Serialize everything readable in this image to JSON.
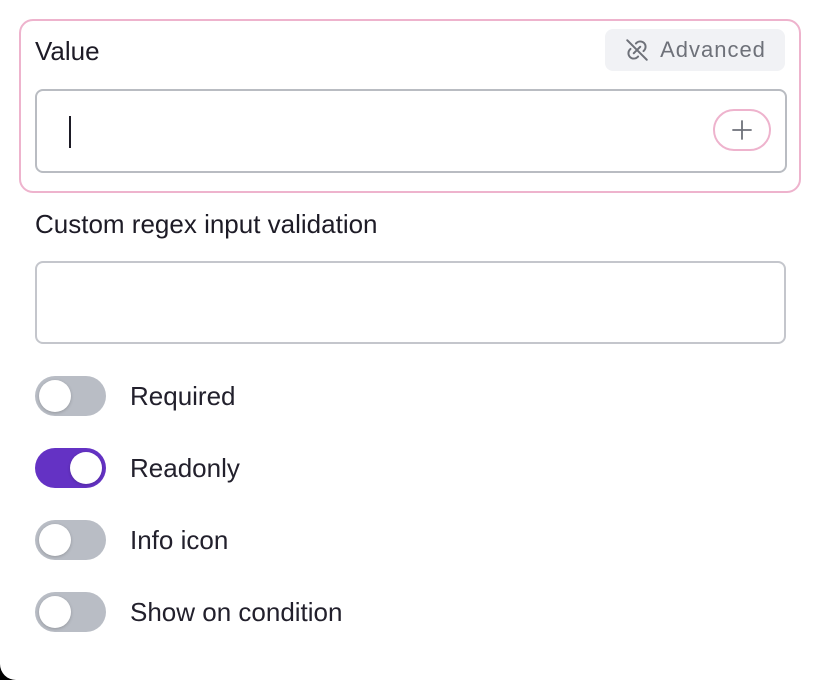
{
  "value_section": {
    "label": "Value",
    "advanced_label": "Advanced",
    "input_value": ""
  },
  "regex": {
    "label": "Custom regex input validation",
    "input_value": ""
  },
  "toggles": [
    {
      "label": "Required",
      "on": false
    },
    {
      "label": "Readonly",
      "on": true
    },
    {
      "label": "Info icon",
      "on": false
    },
    {
      "label": "Show on condition",
      "on": false
    }
  ],
  "colors": {
    "accent": "#6432c4",
    "focus_border": "#eeb3cd",
    "toggle_off": "#b9bdc5"
  },
  "icons": {
    "advanced": "link-off-icon",
    "add": "plus-icon"
  }
}
